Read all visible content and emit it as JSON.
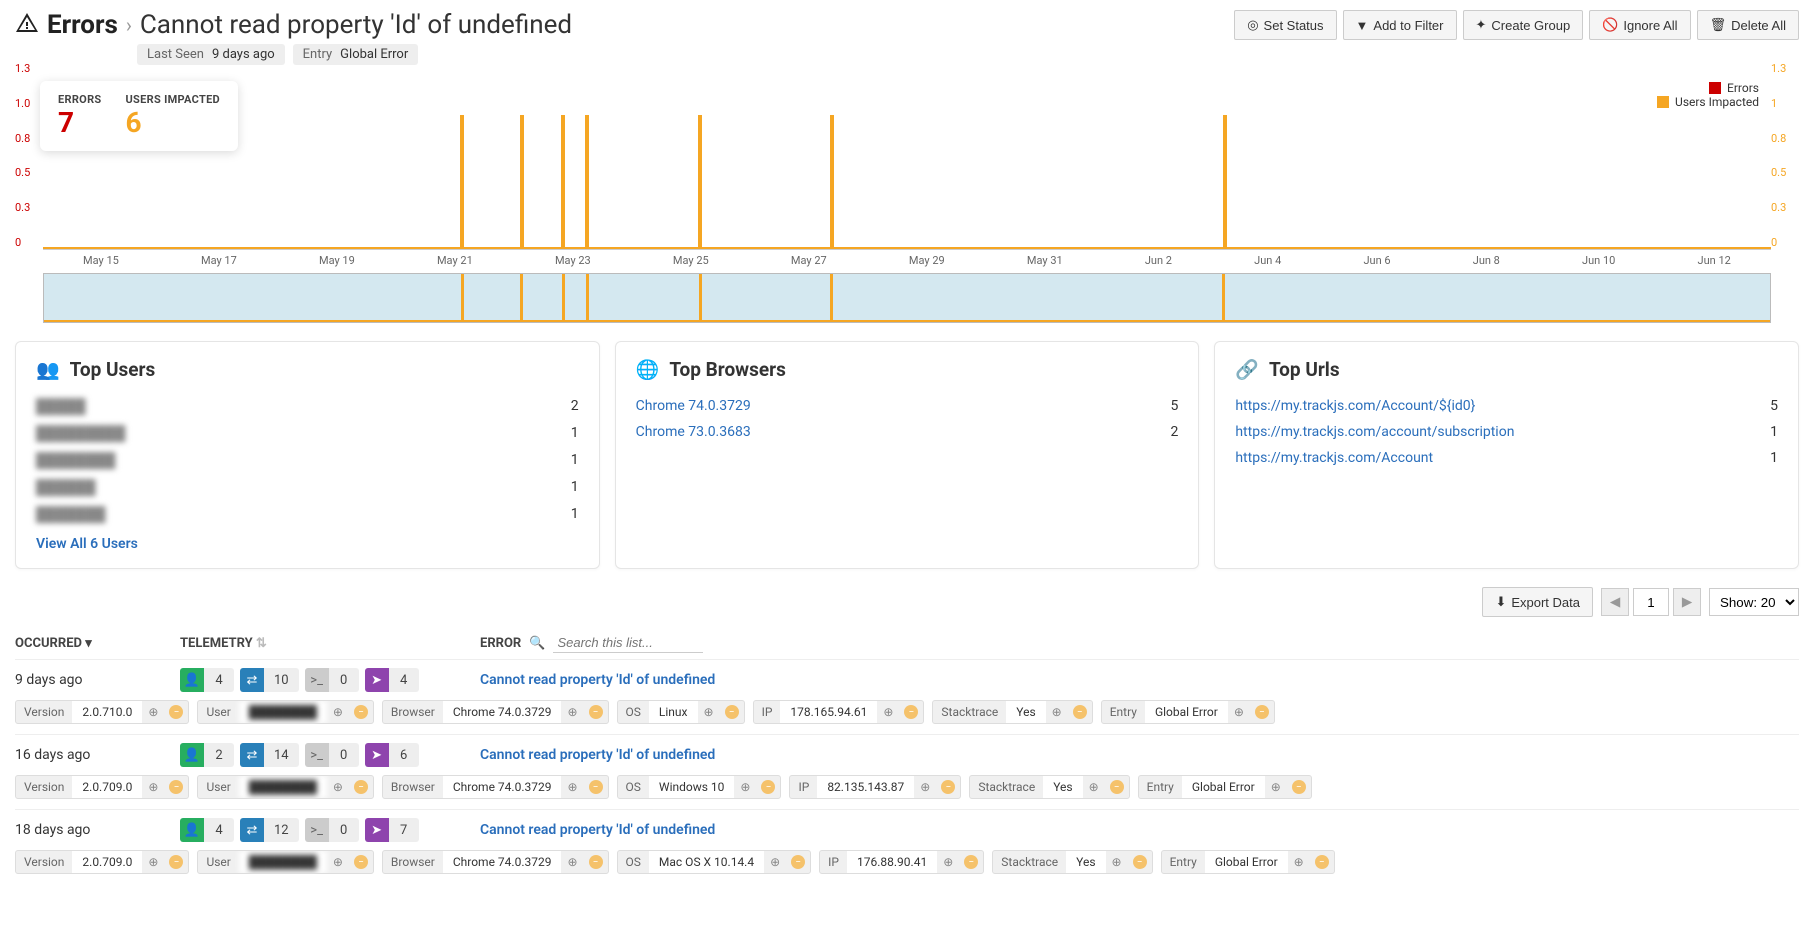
{
  "header": {
    "section": "Errors",
    "title": "Cannot read property 'Id' of undefined",
    "actions": {
      "set_status": "Set Status",
      "add_filter": "Add to Filter",
      "create_group": "Create Group",
      "ignore_all": "Ignore All",
      "delete_all": "Delete All"
    }
  },
  "meta": {
    "last_seen_label": "Last Seen",
    "last_seen": "9 days ago",
    "entry_label": "Entry",
    "entry": "Global Error"
  },
  "summary": {
    "errors_label": "ERRORS",
    "errors": "7",
    "users_label": "USERS IMPACTED",
    "users": "6"
  },
  "legend": {
    "errors": "Errors",
    "users": "Users Impacted"
  },
  "chart_data": {
    "type": "bar",
    "y_ticks_left": [
      "0",
      "0.3",
      "0.5",
      "0.8",
      "1.0",
      "1.3"
    ],
    "y_ticks_right": [
      "0",
      "0.3",
      "0.5",
      "0.8",
      "1",
      "1.3"
    ],
    "x_ticks": [
      "May 15",
      "May 17",
      "May 19",
      "May 21",
      "May 23",
      "May 25",
      "May 27",
      "May 29",
      "May 31",
      "Jun 2",
      "Jun 4",
      "Jun 6",
      "Jun 8",
      "Jun 10",
      "Jun 12"
    ],
    "xlim_days": 29,
    "ylim": [
      0,
      1.3
    ],
    "series": [
      {
        "name": "Errors",
        "color": "#c00",
        "spikes": []
      },
      {
        "name": "Users Impacted",
        "color": "#f5a623",
        "spikes": [
          {
            "day_offset": 7.0,
            "value": 1
          },
          {
            "day_offset": 8.0,
            "value": 1
          },
          {
            "day_offset": 8.7,
            "value": 1
          },
          {
            "day_offset": 9.1,
            "value": 1
          },
          {
            "day_offset": 11.0,
            "value": 1
          },
          {
            "day_offset": 13.2,
            "value": 1
          },
          {
            "day_offset": 19.8,
            "value": 1
          }
        ]
      }
    ]
  },
  "panels": {
    "top_users": {
      "title": "Top Users",
      "items": [
        {
          "name": "█████",
          "count": "2"
        },
        {
          "name": "█████████",
          "count": "1"
        },
        {
          "name": "████████",
          "count": "1"
        },
        {
          "name": "██████",
          "count": "1"
        },
        {
          "name": "███████",
          "count": "1"
        }
      ],
      "link": "View All 6 Users"
    },
    "top_browsers": {
      "title": "Top Browsers",
      "items": [
        {
          "name": "Chrome 74.0.3729",
          "count": "5"
        },
        {
          "name": "Chrome 73.0.3683",
          "count": "2"
        }
      ]
    },
    "top_urls": {
      "title": "Top Urls",
      "items": [
        {
          "name": "https://my.trackjs.com/Account/${id0}",
          "count": "5"
        },
        {
          "name": "https://my.trackjs.com/account/subscription",
          "count": "1"
        },
        {
          "name": "https://my.trackjs.com/Account",
          "count": "1"
        }
      ]
    }
  },
  "list": {
    "export": "Export Data",
    "page": "1",
    "show": "Show: 20",
    "occurred": "OCCURRED",
    "telemetry": "TELEMETRY",
    "error": "ERROR",
    "search_placeholder": "Search this list...",
    "rows": [
      {
        "occurred": "9 days ago",
        "telemetry": {
          "user": "4",
          "net": "10",
          "con": "0",
          "nav": "4"
        },
        "title": "Cannot read property 'Id' of undefined",
        "chips": {
          "version": "2.0.710.0",
          "user": "████████",
          "browser": "Chrome 74.0.3729",
          "os": "Linux",
          "ip": "178.165.94.61",
          "stacktrace": "Yes",
          "entry": "Global Error"
        }
      },
      {
        "occurred": "16 days ago",
        "telemetry": {
          "user": "2",
          "net": "14",
          "con": "0",
          "nav": "6"
        },
        "title": "Cannot read property 'Id' of undefined",
        "chips": {
          "version": "2.0.709.0",
          "user": "████████",
          "browser": "Chrome 74.0.3729",
          "os": "Windows 10",
          "ip": "82.135.143.87",
          "stacktrace": "Yes",
          "entry": "Global Error"
        }
      },
      {
        "occurred": "18 days ago",
        "telemetry": {
          "user": "4",
          "net": "12",
          "con": "0",
          "nav": "7"
        },
        "title": "Cannot read property 'Id' of undefined",
        "chips": {
          "version": "2.0.709.0",
          "user": "████████",
          "browser": "Chrome 74.0.3729",
          "os": "Mac OS X 10.14.4",
          "ip": "176.88.90.41",
          "stacktrace": "Yes",
          "entry": "Global Error"
        }
      }
    ],
    "chip_keys": {
      "version": "Version",
      "user": "User",
      "browser": "Browser",
      "os": "OS",
      "ip": "IP",
      "stacktrace": "Stacktrace",
      "entry": "Entry"
    }
  }
}
